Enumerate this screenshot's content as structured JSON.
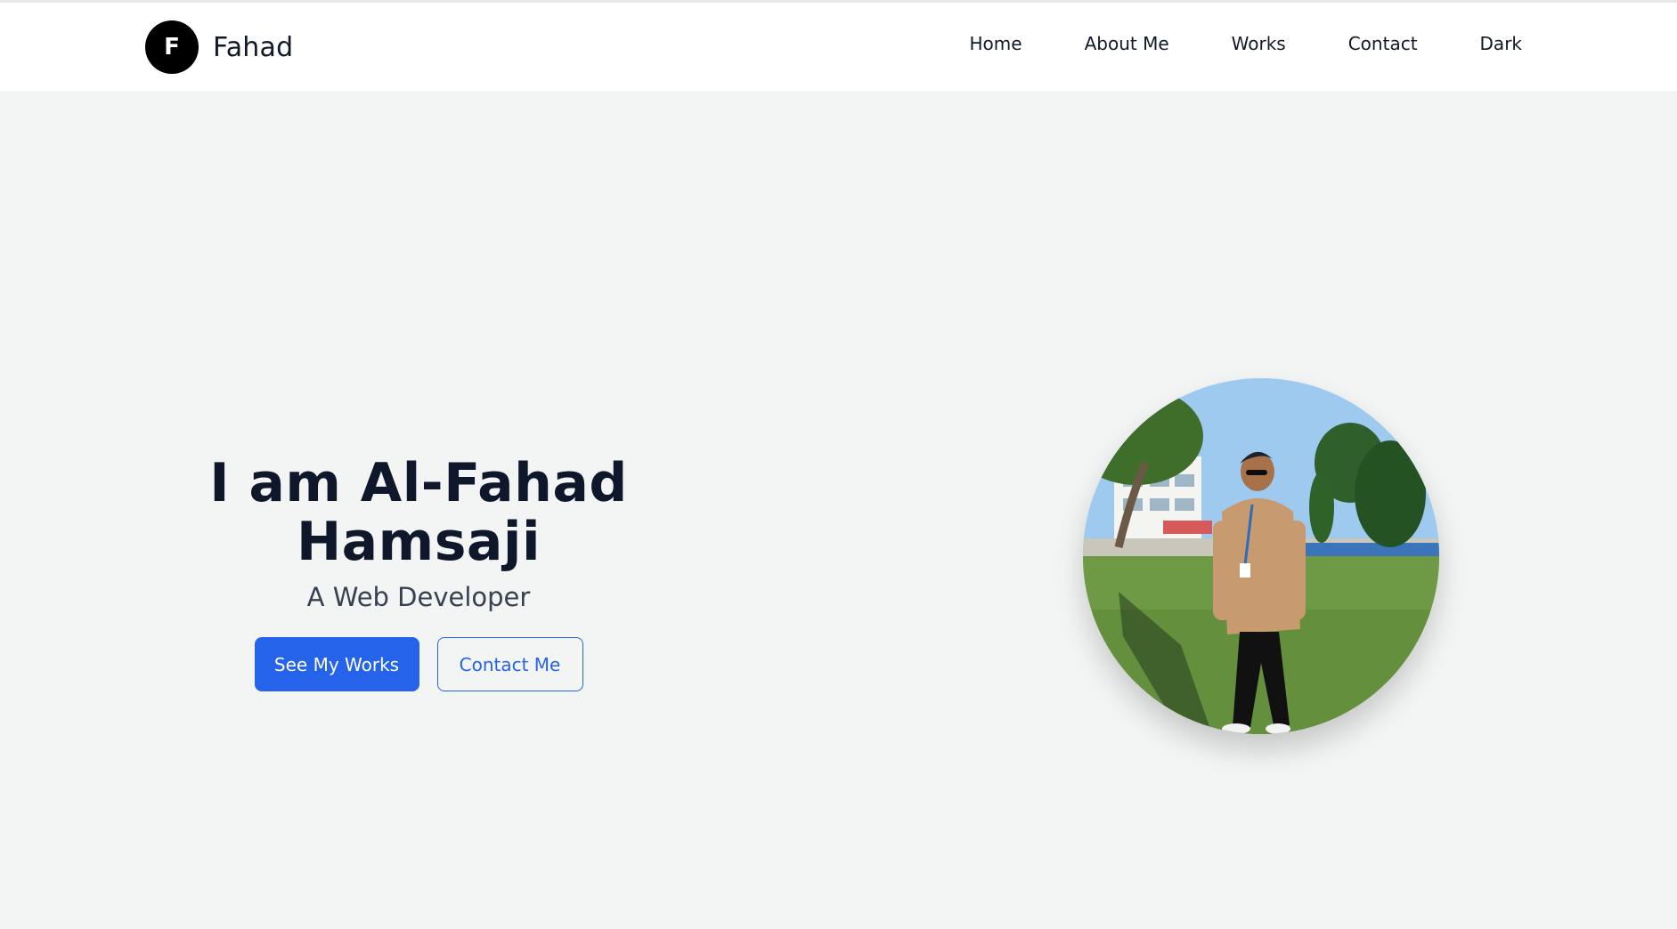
{
  "brand": {
    "initial": "F",
    "name": "Fahad"
  },
  "nav": {
    "items": [
      {
        "label": "Home"
      },
      {
        "label": "About Me"
      },
      {
        "label": "Works"
      },
      {
        "label": "Contact"
      },
      {
        "label": "Dark"
      }
    ]
  },
  "hero": {
    "title": "I am Al-Fahad Hamsaji",
    "subtitle": "A Web Developer",
    "primary_button": "See My Works",
    "secondary_button": "Contact Me"
  },
  "colors": {
    "accent": "#2563eb",
    "background": "#f3f5f5",
    "navbar": "#ffffff",
    "text_dark": "#0f172a"
  }
}
